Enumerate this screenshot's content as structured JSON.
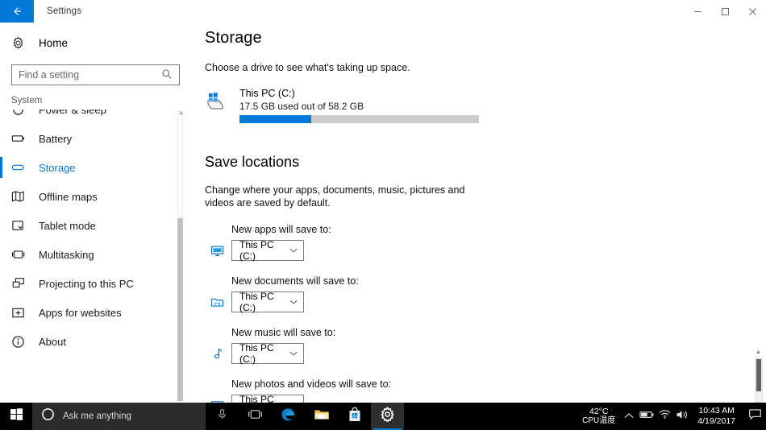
{
  "window": {
    "title": "Settings",
    "back_icon": "back-arrow-icon",
    "minimize_label": "–",
    "maximize_label": "❐",
    "close_label": "✕"
  },
  "sidebar": {
    "home_label": "Home",
    "home_icon": "gear-icon",
    "search": {
      "placeholder": "Find a setting",
      "value": "",
      "icon": "search-icon"
    },
    "group_label": "System",
    "items": [
      {
        "label": "Power & sleep",
        "icon": "power-icon",
        "active": false
      },
      {
        "label": "Battery",
        "icon": "battery-icon",
        "active": false
      },
      {
        "label": "Storage",
        "icon": "storage-icon",
        "active": true
      },
      {
        "label": "Offline maps",
        "icon": "map-icon",
        "active": false
      },
      {
        "label": "Tablet mode",
        "icon": "tablet-icon",
        "active": false
      },
      {
        "label": "Multitasking",
        "icon": "multitasking-icon",
        "active": false
      },
      {
        "label": "Projecting to this PC",
        "icon": "project-icon",
        "active": false
      },
      {
        "label": "Apps for websites",
        "icon": "apps-websites-icon",
        "active": false
      },
      {
        "label": "About",
        "icon": "info-icon",
        "active": false
      }
    ]
  },
  "main": {
    "page_title": "Storage",
    "drive_prompt": "Choose a drive to see what's taking up space.",
    "drive": {
      "name": "This PC (C:)",
      "usage": "17.5 GB used out of 58.2 GB",
      "used_gb": 17.5,
      "total_gb": 58.2,
      "percent_used": 30,
      "icon": "hard-drive-icon",
      "fill_color": "#0078d7",
      "track_color": "#cccccc"
    },
    "save_locations": {
      "title": "Save locations",
      "description": "Change where your apps, documents, music, pictures and videos are saved by default.",
      "rows": [
        {
          "label": "New apps will save to:",
          "value": "This PC (C:)",
          "icon": "monitor-apps-icon"
        },
        {
          "label": "New documents will save to:",
          "value": "This PC (C:)",
          "icon": "documents-folder-icon"
        },
        {
          "label": "New music will save to:",
          "value": "This PC (C:)",
          "icon": "music-note-icon"
        },
        {
          "label": "New photos and videos will save to:",
          "value": "This PC (C:)",
          "icon": "photo-icon"
        }
      ],
      "chevron_icon": "chevron-down-icon"
    }
  },
  "taskbar": {
    "start_icon": "windows-start-icon",
    "search": {
      "placeholder": "Ask me anything",
      "icon": "cortana-circle-icon"
    },
    "mic_icon": "microphone-icon",
    "apps": [
      {
        "name": "task-view",
        "icon": "task-view-icon",
        "active": false
      },
      {
        "name": "edge",
        "icon": "edge-browser-icon",
        "active": false
      },
      {
        "name": "file-explorer",
        "icon": "folder-icon",
        "active": false
      },
      {
        "name": "store",
        "icon": "store-bag-icon",
        "active": false
      },
      {
        "name": "settings",
        "icon": "gear-icon",
        "active": true
      }
    ],
    "tray": {
      "temperature": "42°C",
      "temperature_caption": "CPU温度",
      "chevron_icon": "chevron-up-icon",
      "battery_icon": "battery-icon",
      "network_icon": "wifi-icon",
      "volume_icon": "speaker-icon",
      "time": "10:43 AM",
      "date": "4/19/2017",
      "notification_icon": "notification-icon"
    }
  }
}
